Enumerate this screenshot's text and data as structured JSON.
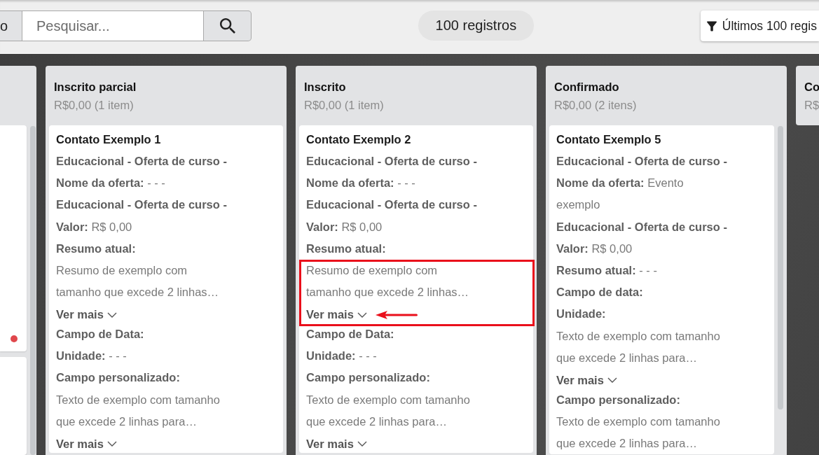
{
  "toolbar": {
    "left_button": {
      "label": "o"
    },
    "search": {
      "placeholder": "Pesquisar..."
    },
    "record_count": "100 registros",
    "filter_button": {
      "label": "Últimos 100 regis"
    }
  },
  "columns": [
    {
      "scrollbar": true,
      "cards": [
        {
          "kind": "clipped",
          "color": "#e0474c"
        },
        {
          "kind": "clipped"
        }
      ]
    },
    {
      "title": "Inscrito parcial",
      "total": "R$0,00 (1 item)",
      "scrollbar": false,
      "cards": [
        {
          "kind": "contact",
          "title": "Contato Exemplo 1",
          "fields": [
            {
              "kind": "label",
              "text": "Educacional - Oferta de curso -"
            },
            {
              "kind": "line",
              "text": "**Nome da oferta:** - - -"
            },
            {
              "kind": "label",
              "text": "Educacional - Oferta de curso -"
            },
            {
              "kind": "line",
              "text": "**Valor:** R$ 0,00"
            },
            {
              "kind": "label",
              "text": "Resumo atual:"
            },
            {
              "kind": "excerpt",
              "text": "Resumo de exemplo com tamanho que excede 2 linhas…",
              "toggle": "Ver mais",
              "expanded": false,
              "highlighted": false
            },
            {
              "kind": "label",
              "text": "Campo de Data:"
            },
            {
              "kind": "line",
              "text": "**Unidade:** - - -"
            },
            {
              "kind": "label",
              "text": "Campo personalizado:"
            },
            {
              "kind": "excerpt",
              "text": "Texto de exemplo com tamanho que excede 2 linhas para…",
              "toggle": "Ver mais",
              "expanded": false,
              "highlighted": false
            }
          ]
        }
      ]
    },
    {
      "title": "Inscrito",
      "total": "R$0,00 (1 item)",
      "scrollbar": false,
      "cards": [
        {
          "kind": "contact",
          "title": "Contato Exemplo 2",
          "fields": [
            {
              "kind": "label",
              "text": "Educacional - Oferta de curso -"
            },
            {
              "kind": "line",
              "text": "**Nome da oferta:** - - -"
            },
            {
              "kind": "label",
              "text": "Educacional - Oferta de curso -"
            },
            {
              "kind": "line",
              "text": "**Valor:** R$ 0,00"
            },
            {
              "kind": "label",
              "text": "Resumo atual:"
            },
            {
              "kind": "excerpt",
              "text": "Resumo de exemplo com tamanho que excede 2 linhas…",
              "toggle": "Ver mais",
              "expanded": false,
              "highlighted": true
            },
            {
              "kind": "label",
              "text": "Campo de Data:"
            },
            {
              "kind": "line",
              "text": "**Unidade:** - - -"
            },
            {
              "kind": "label",
              "text": "Campo personalizado:"
            },
            {
              "kind": "excerpt",
              "text": "Texto de exemplo com tamanho que excede 2 linhas para…",
              "toggle": "Ver mais",
              "expanded": false,
              "highlighted": false
            }
          ]
        }
      ]
    },
    {
      "title": "Confirmado",
      "total": "R$0,00 (2 itens)",
      "scrollbar": true,
      "cards": [
        {
          "kind": "contact",
          "title": "Contato Exemplo 5",
          "fields": [
            {
              "kind": "label",
              "text": "Educacional - Oferta de curso -"
            },
            {
              "kind": "line",
              "text": "**Nome da oferta:** Evento exemplo"
            },
            {
              "kind": "label",
              "text": "Educacional - Oferta de curso -"
            },
            {
              "kind": "line",
              "text": "**Valor:** R$ 0,00"
            },
            {
              "kind": "line",
              "text": "**Resumo atual:** - - -"
            },
            {
              "kind": "label",
              "text": "Campo de data:"
            },
            {
              "kind": "label",
              "text": "Unidade:"
            },
            {
              "kind": "excerpt",
              "text": "Texto de exemplo com tamanho que excede 2 linhas para…",
              "toggle": "Ver mais",
              "expanded": false,
              "highlighted": false
            },
            {
              "kind": "label",
              "text": "Campo personalizado:"
            },
            {
              "kind": "excerpt",
              "text": "Texto de exemplo com tamanho que excede 2 linhas para…",
              "highlighted": false
            }
          ]
        }
      ]
    },
    {
      "title": "Co",
      "total": "R$"
    }
  ]
}
